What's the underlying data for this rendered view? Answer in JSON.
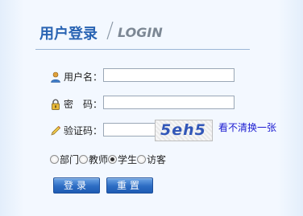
{
  "header": {
    "title_zh": "用户登录",
    "title_en": "LOGIN"
  },
  "form": {
    "username_label": "用户名：",
    "password_label": "密　码：",
    "captcha_label": "验证码：",
    "username_value": "",
    "password_value": "",
    "captcha_value": "",
    "captcha_image_text": "5eh5",
    "refresh_link": "看不清换一张"
  },
  "roles": {
    "options": [
      "部门",
      "教师",
      "学生",
      "访客"
    ],
    "selected": "学生"
  },
  "buttons": {
    "login": "登录",
    "reset": "重置"
  },
  "colors": {
    "title_blue": "#2a64b3",
    "button_blue": "#2c6cc3",
    "link_blue": "#1b1bd1"
  },
  "icons": {
    "username": "user-icon",
    "password": "lock-icon",
    "captcha": "pencil-icon"
  }
}
